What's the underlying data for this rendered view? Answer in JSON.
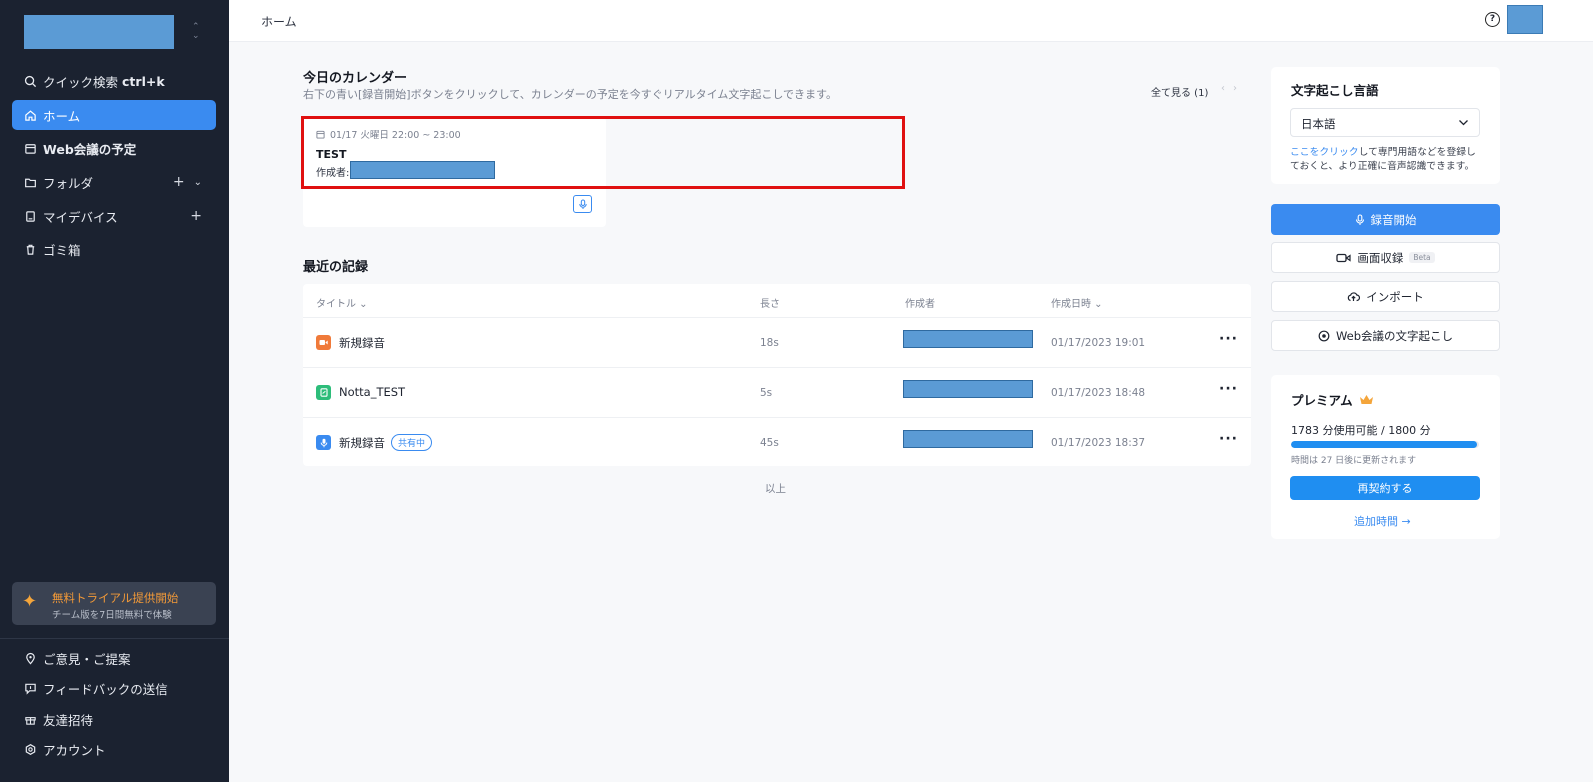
{
  "sidebar": {
    "quick_search": "クイック検索",
    "quick_search_shortcut": "ctrl+k",
    "home": "ホーム",
    "web_meetings": "Web会議の予定",
    "folders": "フォルダ",
    "my_devices": "マイデバイス",
    "trash": "ゴミ箱",
    "trial_title": "無料トライアル提供開始",
    "trial_subtitle": "チーム版を7日間無料で体験",
    "feedback_suggestion": "ご意見・ご提案",
    "send_feedback": "フィードバックの送信",
    "invite_friends": "友達招待",
    "account": "アカウント"
  },
  "header": {
    "breadcrumb": "ホーム"
  },
  "calendar": {
    "title": "今日のカレンダー",
    "description": "右下の青い[録音開始]ボタンをクリックして、カレンダーの予定を今すぐリアルタイム文字起こしできます。",
    "see_all": "全て見る (1)",
    "event": {
      "time": "01/17 火曜日 22:00 ~ 23:00",
      "title": "TEST",
      "creator_label": "作成者:"
    }
  },
  "recent": {
    "title": "最近の記録",
    "columns": {
      "title": "タイトル",
      "length": "長さ",
      "creator": "作成者",
      "created_at": "作成日時"
    },
    "rows": [
      {
        "name": "新規録音",
        "length": "18s",
        "date": "01/17/2023 19:01",
        "icon": "video-icon",
        "color": "#f07a3a"
      },
      {
        "name": "Notta_TEST",
        "length": "5s",
        "date": "01/17/2023 18:48",
        "icon": "file-icon",
        "color": "#2dbd7a"
      },
      {
        "name": "新規録音",
        "badge": "共有中",
        "length": "45s",
        "date": "01/17/2023 18:37",
        "icon": "mic-icon",
        "color": "#3a8bf0"
      }
    ],
    "end_note": "以上"
  },
  "right": {
    "lang_title": "文字起こし言語",
    "lang_value": "日本語",
    "lang_note_link": "ここをクリック",
    "lang_note_rest": "して専門用語などを登録しておくと、より正確に音声認識できます。",
    "record_button": "録音開始",
    "screen_record_button": "画面収録",
    "beta": "Beta",
    "import_button": "インポート",
    "web_transcribe_button": "Web会議の文字起こし",
    "premium_title": "プレミアム",
    "usage": "1783 分使用可能 / 1800 分",
    "usage_fraction": 0.99,
    "renew_note": "時間は 27 日後に更新されます",
    "renew_button": "再契約する",
    "add_time": "追加時間 →"
  },
  "colors": {
    "accent": "#3a8bf0",
    "sidebar_bg": "#1b2230",
    "highlight": "#e01010",
    "trial_text": "#f39a38"
  }
}
